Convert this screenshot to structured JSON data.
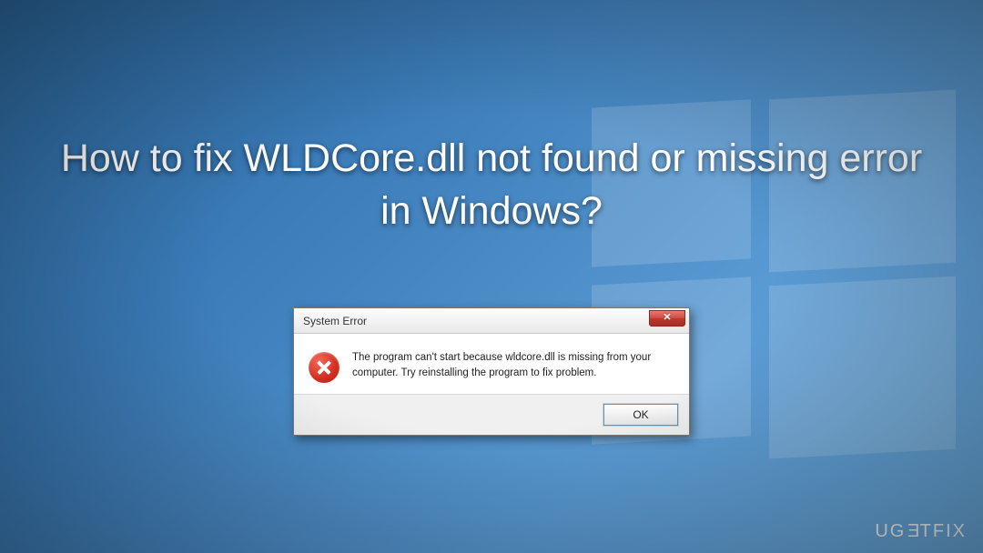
{
  "headline": "How to fix WLDCore.dll not found or missing error in Windows?",
  "dialog": {
    "title": "System Error",
    "close_glyph": "✕",
    "message": "The program can't start because wldcore.dll is missing from your computer. Try reinstalling the program to fix problem.",
    "ok_label": "OK"
  },
  "watermark": {
    "prefix": "UG",
    "e": "E",
    "suffix": "TFIX"
  }
}
